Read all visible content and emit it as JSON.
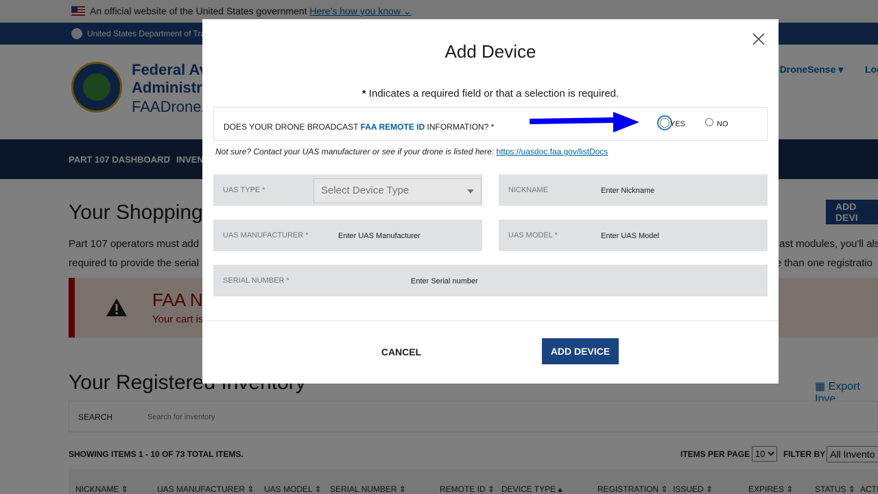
{
  "banner": {
    "text": "An official website of the United States government",
    "link": "Here's how you know",
    "agency": "United States Department of Tra"
  },
  "header": {
    "org_line1": "Federal Av",
    "org_line2": "Administra",
    "site_name": "FAADroneZ",
    "user_menu": "i, DroneSense",
    "logout": "Log"
  },
  "nav": {
    "item1": "PART 107 DASHBOARD",
    "separator": "/",
    "item2": "INVEN"
  },
  "page": {
    "cart_heading": "Your Shopping C",
    "add_device_button": "ADD DEVI",
    "intro_line1_start": "Part 107 operators must add r",
    "intro_line1_end": "ast modules, you'll als",
    "intro_line2_start": "required to provide the serial",
    "intro_line2_end": "re than one registratio",
    "alert_title": "FAA Not",
    "alert_text": "Your cart is e",
    "inventory_heading": "Your Registered Inventory",
    "export_link": "Export Inve",
    "search_label": "SEARCH",
    "search_placeholder": "Search for inventory",
    "showing": "SHOWING ITEMS 1 - 10 OF 73 TOTAL ITEMS.",
    "items_per_page_label": "ITEMS PER PAGE",
    "items_per_page_value": "10",
    "filter_label": "FILTER BY",
    "filter_value": "All Invento",
    "columns": [
      "NICKNAME",
      "UAS MANUFACTURER",
      "UAS MODEL",
      "SERIAL NUMBER",
      "REMOTE ID",
      "DEVICE TYPE",
      "REGISTRATION",
      "ISSUED",
      "EXPIRES",
      "STATUS",
      "ACTI"
    ]
  },
  "modal": {
    "title": "Add Device",
    "required_star": "*",
    "required_note": " Indicates a required field or that a selection is required.",
    "question_start": "DOES YOUR DRONE BROADCAST ",
    "question_link": "FAA REMOTE ID",
    "question_end": " INFORMATION? *",
    "yes_label": "YES",
    "no_label": "NO",
    "hint_text": "Not sure? Contact your UAS manufacturer or see if your drone is listed here: ",
    "hint_link": "https://uasdoc.faa.gov/listDocs",
    "uas_type_label": "UAS TYPE *",
    "uas_type_select": "Select Device Type",
    "nickname_label": "NICKNAME",
    "nickname_placeholder": "Enter Nickname",
    "manufacturer_label": "UAS MANUFACTURER *",
    "manufacturer_placeholder": "Enter UAS Manufacturer",
    "model_label": "UAS MODEL *",
    "model_placeholder": "Enter UAS Model",
    "serial_label": "SERIAL NUMBER *",
    "serial_placeholder": "Enter Serial number",
    "cancel": "CANCEL",
    "add_device": "ADD DEVICE"
  },
  "colors": {
    "primary": "#1a4480",
    "link": "#005ea2",
    "annotation_arrow": "#0000ee",
    "alert": "#b50909"
  }
}
